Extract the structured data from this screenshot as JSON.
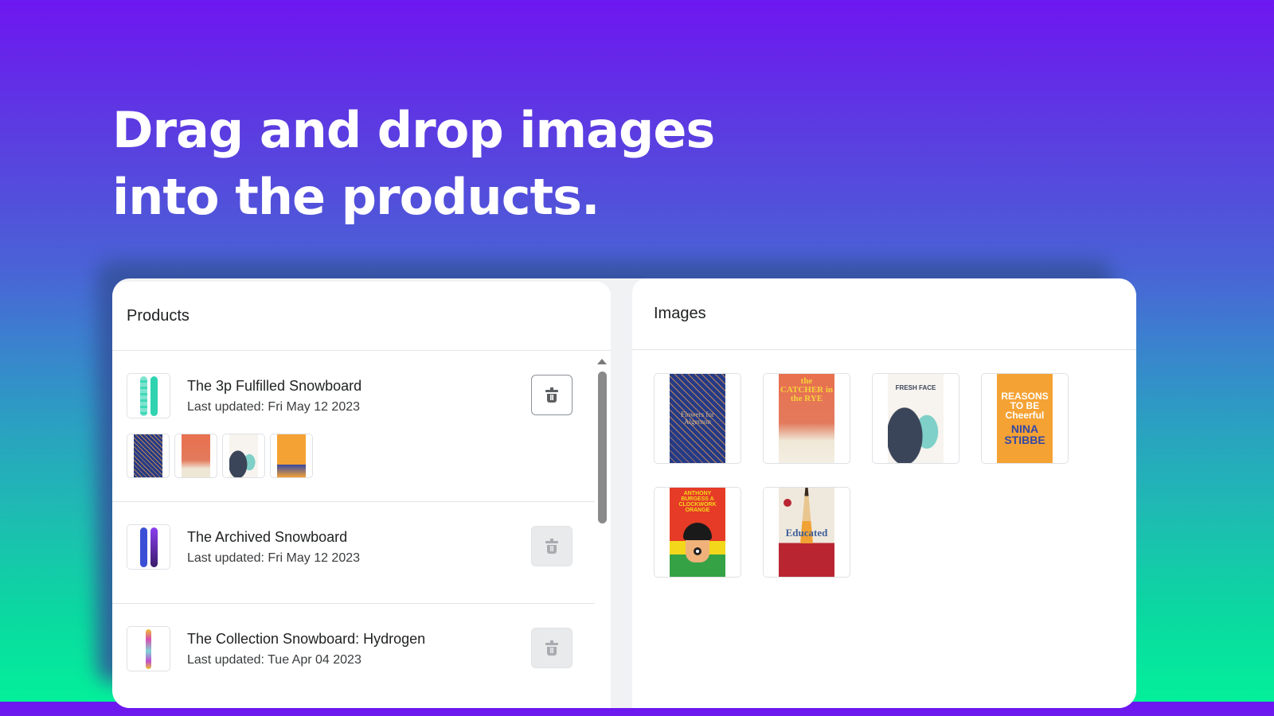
{
  "headline": {
    "line1": "Drag and drop images",
    "line2": "into the products."
  },
  "colors": {
    "gradient_top": "#6e16f0",
    "gradient_bottom": "#03f09a",
    "card_bg": "#ffffff",
    "divider": "#e1e3e5"
  },
  "products_panel": {
    "title": "Products",
    "items": [
      {
        "name": "The 3p Fulfilled Snowboard",
        "last_updated": "Last updated: Fri May 12 2023",
        "thumbnail": "snowboard-teal",
        "delete_enabled": true,
        "delete_icon": "trash-icon",
        "attached_images": [
          "Flowers for Algernon",
          "The Catcher in the Rye",
          "Fresh Face",
          "Reasons to Be Cheerful"
        ]
      },
      {
        "name": "The Archived Snowboard",
        "last_updated": "Last updated: Fri May 12 2023",
        "thumbnail": "snowboard-blue-purple",
        "delete_enabled": false,
        "delete_icon": "trash-icon",
        "attached_images": []
      },
      {
        "name": "The Collection Snowboard: Hydrogen",
        "last_updated": "Last updated: Tue Apr 04 2023",
        "thumbnail": "snowboard-hydrogen",
        "delete_enabled": false,
        "delete_icon": "trash-icon",
        "attached_images": []
      }
    ]
  },
  "images_panel": {
    "title": "Images",
    "items": [
      {
        "title": "Flowers for Algernon",
        "cover_text": "Flowers for Algernon"
      },
      {
        "title": "The Catcher in the Rye",
        "cover_text": "the CATCHER in the RYE"
      },
      {
        "title": "Fresh Face",
        "cover_text": "FRESH FACE"
      },
      {
        "title": "Reasons to Be Cheerful",
        "cover_text": "REASONS TO BE Cheerful",
        "author": "NINA STIBBE"
      },
      {
        "title": "A Clockwork Orange",
        "cover_text": "ANTHONY BURGESS A CLOCKWORK ORANGE"
      },
      {
        "title": "Educated",
        "cover_text": "Educated"
      }
    ]
  }
}
